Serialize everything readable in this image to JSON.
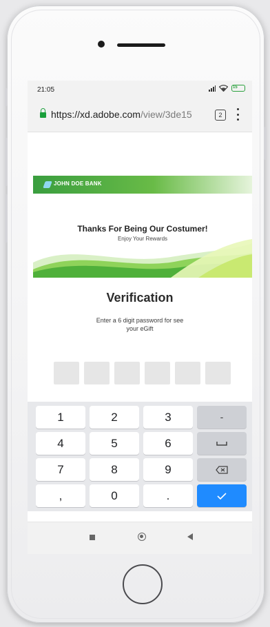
{
  "status_bar": {
    "time": "21:05",
    "icons": [
      "signal-icon",
      "wifi-icon",
      "battery-icon"
    ],
    "battery_level": "15"
  },
  "browser": {
    "url_host": "https://xd.adobe.com",
    "url_path": "/view/3de15",
    "tab_count": "2"
  },
  "bank": {
    "name": "JOHN DOE BANK"
  },
  "banner": {
    "title": "Thanks For Being Our Costumer!",
    "subtitle": "Enjoy Your Rewards"
  },
  "verification": {
    "title": "Verification",
    "description": "Enter a 6 digit password for see your eGift",
    "code_boxes": 6
  },
  "keypad": {
    "rows": [
      [
        "1",
        "2",
        "3",
        "-"
      ],
      [
        "4",
        "5",
        "6",
        "space"
      ],
      [
        "7",
        "8",
        "9",
        "backspace"
      ],
      [
        ",",
        "0",
        ".",
        "done"
      ]
    ],
    "accent_color": "#1f8bff"
  },
  "nav": {
    "icons": [
      "recent-apps-icon",
      "home-icon",
      "back-icon"
    ]
  }
}
